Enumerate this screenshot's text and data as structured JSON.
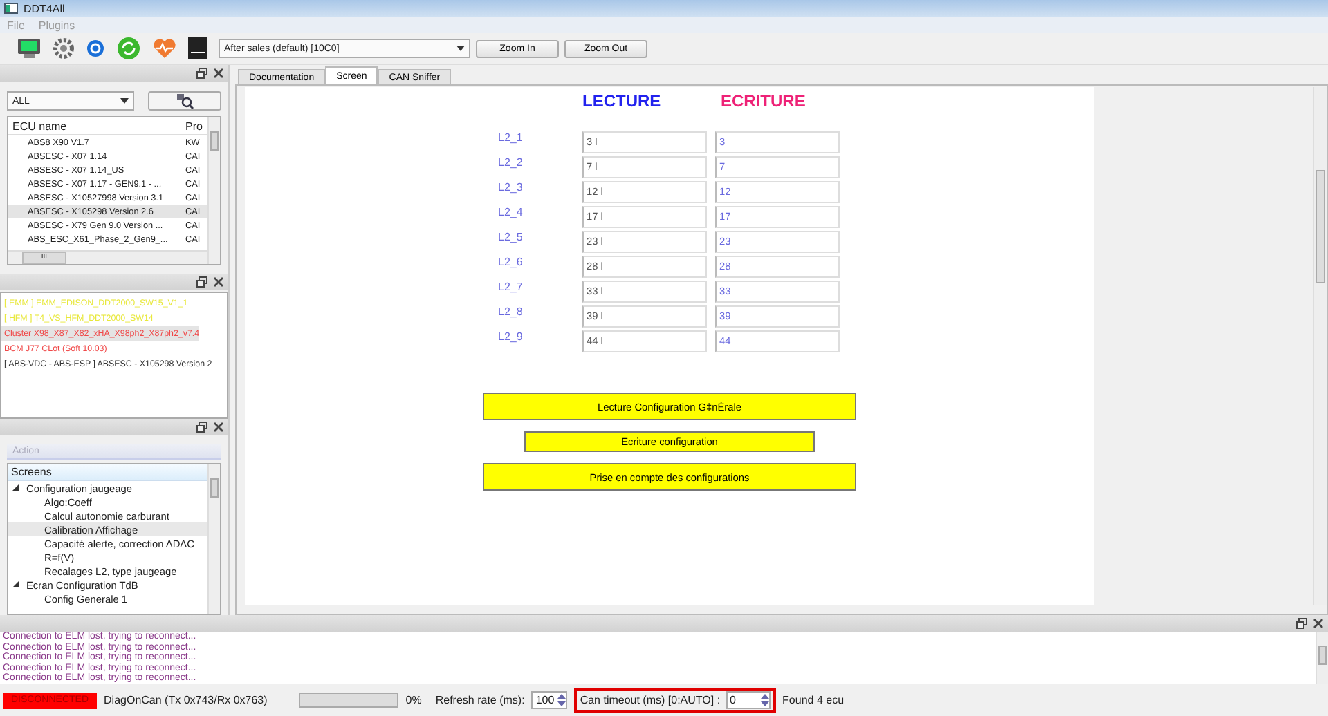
{
  "window": {
    "title": "DDT4All"
  },
  "menu": [
    "File",
    "Plugins"
  ],
  "toolbar": {
    "mode_select": "After sales (default) [10C0]",
    "buttons": [
      "Zoom In",
      "Zoom Out"
    ]
  },
  "ecu_panel": {
    "filter": "ALL",
    "columns": [
      "ECU name",
      "Pro"
    ],
    "rows": [
      {
        "name": "ABS8 X90 V1.7",
        "protocol": "KW",
        "selected": false
      },
      {
        "name": "ABSESC - X07 1.14",
        "protocol": "CAI",
        "selected": false
      },
      {
        "name": "ABSESC - X07 1.14_US",
        "protocol": "CAI",
        "selected": false
      },
      {
        "name": "ABSESC - X07 1.17 - GEN9.1 - ...",
        "protocol": "CAI",
        "selected": false
      },
      {
        "name": "ABSESC - X10527998 Version 3.1",
        "protocol": "CAI",
        "selected": false
      },
      {
        "name": "ABSESC - X105298 Version 2.6",
        "protocol": "CAI",
        "selected": true
      },
      {
        "name": "ABSESC - X79 Gen 9.0 Version ...",
        "protocol": "CAI",
        "selected": false
      },
      {
        "name": "ABS_ESC_X61_Phase_2_Gen9_...",
        "protocol": "CAI",
        "selected": false
      }
    ],
    "scroll_label": "III"
  },
  "found_ecus": [
    {
      "label": "[ EMM ] EMM_EDISON_DDT2000_SW15_V1_1",
      "color": "#e8e83a",
      "selected": false
    },
    {
      "label": "[ HFM ] T4_VS_HFM_DDT2000_SW14",
      "color": "#e8e83a",
      "selected": false
    },
    {
      "label": "Cluster X98_X87_X82_xHA_X98ph2_X87ph2_v7.4",
      "color": "#f04848",
      "selected": true
    },
    {
      "label": "BCM J77 CLot (Soft 10.03)",
      "color": "#f04848",
      "selected": false
    },
    {
      "label": "[ ABS-VDC - ABS-ESP ] ABSESC - X105298 Version 2",
      "color": "#333333",
      "selected": false
    }
  ],
  "screens_panel": {
    "action_placeholder": "Action",
    "header": "Screens",
    "tree": [
      {
        "label": "Configuration jaugeage",
        "expanded": true,
        "selected": false,
        "children": [
          {
            "label": "Algo:Coeff",
            "selected": false
          },
          {
            "label": "Calcul autonomie carburant",
            "selected": false
          },
          {
            "label": "Calibration Affichage",
            "selected": true
          },
          {
            "label": "Capacité alerte, correction ADAC",
            "selected": false
          },
          {
            "label": "R=f(V)",
            "selected": false
          },
          {
            "label": "Recalages L2, type jaugeage",
            "selected": false
          }
        ]
      },
      {
        "label": "Ecran Configuration TdB",
        "expanded": true,
        "selected": false,
        "children": [
          {
            "label": "Config Generale 1",
            "selected": false
          }
        ]
      }
    ]
  },
  "tabs": [
    {
      "label": "Documentation",
      "selected": false
    },
    {
      "label": "Screen",
      "selected": true
    },
    {
      "label": "CAN Sniffer",
      "selected": false
    }
  ],
  "screen": {
    "read_heading": "LECTURE",
    "write_heading": "ECRITURE",
    "rows": [
      {
        "label": "L2_1",
        "read": "3 l",
        "write": "3"
      },
      {
        "label": "L2_2",
        "read": "7 l",
        "write": "7"
      },
      {
        "label": "L2_3",
        "read": "12 l",
        "write": "12"
      },
      {
        "label": "L2_4",
        "read": "17 l",
        "write": "17"
      },
      {
        "label": "L2_5",
        "read": "23 l",
        "write": "23"
      },
      {
        "label": "L2_6",
        "read": "28 l",
        "write": "28"
      },
      {
        "label": "L2_7",
        "read": "33 l",
        "write": "33"
      },
      {
        "label": "L2_8",
        "read": "39 l",
        "write": "39"
      },
      {
        "label": "L2_9",
        "read": "44 l",
        "write": "44"
      }
    ],
    "buttons": [
      {
        "label": "Lecture Configuration G‡nÈrale",
        "kind": "wide"
      },
      {
        "label": "Ecriture configuration",
        "kind": "narrow"
      },
      {
        "label": "Prise en compte des configurations",
        "kind": "wide"
      }
    ]
  },
  "log": [
    "Connection to ELM lost, trying to reconnect...",
    "Connection to ELM lost, trying to reconnect...",
    "Connection to ELM lost, trying to reconnect...",
    "Connection to ELM lost, trying to reconnect...",
    "Connection to ELM lost, trying to reconnect..."
  ],
  "status_bar": {
    "connection": "DISCONNECTED",
    "connected": false,
    "protocol": "DiagOnCan (Tx 0x743/Rx 0x763)",
    "progress": {
      "level": 0,
      "reading": "0%"
    },
    "refresh_label": "Refresh rate (ms):",
    "refresh_value": "100",
    "timeout_label": "Can timeout (ms) [0:AUTO] :",
    "timeout_value": "0",
    "timeout_highlighted": true,
    "found": "Found 4 ecu"
  }
}
